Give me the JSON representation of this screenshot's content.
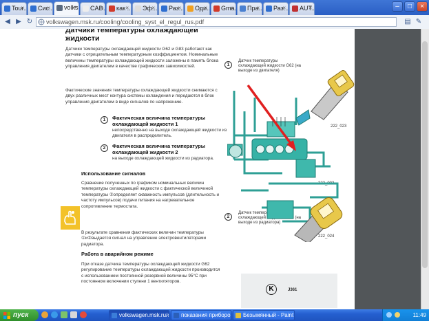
{
  "browser": {
    "tabs": [
      {
        "label": "Tour...",
        "color": "#2f6fd0"
      },
      {
        "label": "Сис...",
        "color": "#2f6fd0"
      },
      {
        "label": "volks...",
        "color": "#5a6a80",
        "active": true
      },
      {
        "label": "CAD...",
        "color": "#eeeeee"
      },
      {
        "label": "как ...",
        "color": "#d23a2a"
      },
      {
        "label": "Эф...",
        "color": "#dddddd"
      },
      {
        "label": "Раз...",
        "color": "#2f6fd0"
      },
      {
        "label": "Оди...",
        "color": "#f0a020"
      },
      {
        "label": "Gma...",
        "color": "#d23a2a"
      },
      {
        "label": "Пра...",
        "color": "#4a80d0"
      },
      {
        "label": "Раз...",
        "color": "#2f6fd0"
      },
      {
        "label": "AUT...",
        "color": "#c03030"
      }
    ],
    "url": "volkswagen.msk.ru/cooling/cooling_syst_el_regul_rus.pdf",
    "window_buttons": {
      "minimize": "–",
      "maximize": "□",
      "close": "×"
    }
  },
  "document": {
    "title": "Датчики температуры охлаждающей жидкости",
    "intro": "Датчики температуры охлаждающей жидкости G62 и G83 работают как датчики с отрицательным температурным коэффициентом. Номинальные величины температуры охлаждающей жидкости заложены в память блока управления двигателем в качестве графических зависимостей.",
    "para2": "Фактические значения температуры охлаждающей жидкости снимаются с двух различных мест контура системы охлаждения и передаются в блок управления двигателем в виде сигналов по напряжению.",
    "items": [
      {
        "num": "1",
        "heading": "Фактическая величина температуры охлаждающей жидкости 1",
        "text": "непосредственно на выходе охлаждающей жидкости из двигателя в распределитель."
      },
      {
        "num": "2",
        "heading": "Фактическая величина температуры охлаждающей жидкости 2",
        "text": "на выходе охлаждающей жидкости из радиатора."
      }
    ],
    "section_signals": {
      "heading": "Использование сигналов",
      "text1": "Сравнение полученных по графиком номинальных величин температуры охлаждающей жидкости с фактической величиной температуры ①определяет скважность импульсов (длительность и частоту импульсов) подачи питания на нагревательное сопротивление термостата.",
      "text2": "В результате сравнения фактических величин температуры ①и②выдается сигнал на управление электровентиляторами радиатора."
    },
    "section_emergency": {
      "heading": "Работа в аварийном режиме",
      "text": "При отказе датчика температуры охлаждающей жидкости G62 регулирование температуры охлаждающей жидкости производится с использованием постоянной резервной величины 95°С при постоянном включении ступени 1 вентиляторов."
    },
    "diagram": {
      "marker1": "1",
      "marker2": "2",
      "label_g62": "Датчик температуры охлаждающей жидкости G62 (на выходе из двигателя)",
      "label_g83": "Датчик температуры охлаждающей жидкости G83 (на выходе из радиатора)",
      "parts": [
        "222_023",
        "222_003",
        "222_024"
      ],
      "relay": {
        "symbol": "K",
        "label": "J361"
      },
      "colors": {
        "pipe": "#2e9f95",
        "arrow": "#e02020",
        "sensor_yellow": "#e8c84a"
      }
    }
  },
  "taskbar": {
    "start": "пуск",
    "buttons": [
      {
        "label": "volkswagen.msk.ru/c...",
        "active": true
      },
      {
        "label": "показания приборо..."
      },
      {
        "label": "Безымянный - Paint"
      }
    ],
    "clock": "11:49"
  }
}
